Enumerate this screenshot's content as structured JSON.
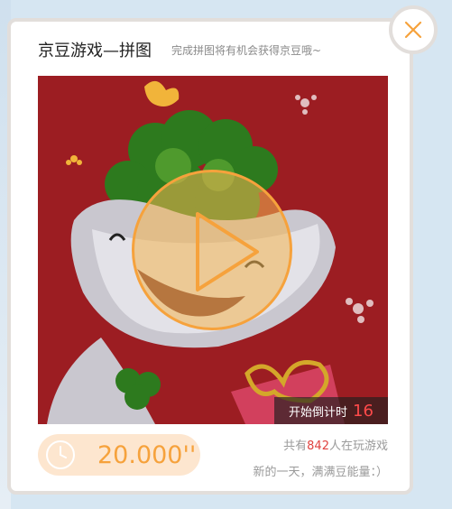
{
  "header": {
    "title": "京豆游戏—拼图",
    "subtitle": "完成拼图将有机会获得京豆哦~"
  },
  "game": {
    "countdown_label": "开始倒计时",
    "countdown_value": "16"
  },
  "footer": {
    "timer_value": "20.000''",
    "players_prefix": "共有",
    "players_count": "842",
    "players_suffix": "人在玩游戏",
    "motto": "新的一天，满满豆能量：）"
  },
  "icons": {
    "close": "close-icon",
    "play": "play-icon",
    "clock": "clock-icon"
  },
  "colors": {
    "accent": "#f6a23c",
    "highlight": "#e0423f",
    "image_background": "#9c1d22",
    "timer_background": "#fde6cf"
  }
}
